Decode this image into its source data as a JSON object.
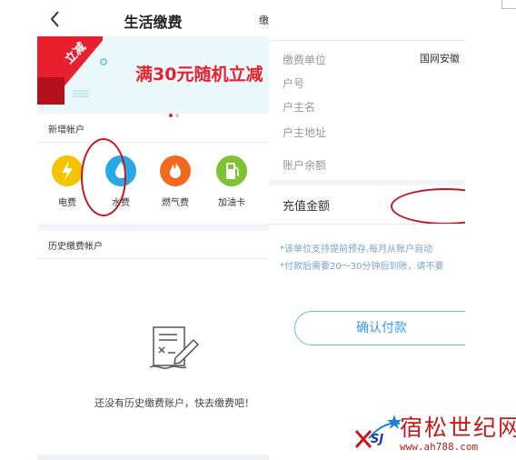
{
  "left_screen": {
    "nav": {
      "title": "生活缴费",
      "right_text": "缴"
    },
    "banner": {
      "badge": "立减",
      "promo_text": "满30元随机立减",
      "page_dots": 2
    },
    "new_account_section": {
      "title": "新增帐户",
      "services": [
        {
          "label": "电费",
          "icon": "lightning-icon",
          "color": "#f5c300"
        },
        {
          "label": "水费",
          "icon": "water-drop-icon",
          "color": "#2aa7e6"
        },
        {
          "label": "燃气费",
          "icon": "flame-icon",
          "color": "#f26a22"
        },
        {
          "label": "加油卡",
          "icon": "fuel-pump-icon",
          "color": "#7fc234"
        }
      ]
    },
    "history_section": {
      "title": "历史缴费帐户",
      "empty_text": "还没有历史缴费账户，快去缴费吧！"
    }
  },
  "right_screen": {
    "fields": [
      {
        "label": "缴费单位",
        "value": "国网安徽"
      },
      {
        "label": "户号",
        "value": ""
      },
      {
        "label": "户主名",
        "value": ""
      },
      {
        "label": "户主地址",
        "value": ""
      },
      {
        "label": "账户余额",
        "value": ""
      }
    ],
    "amount_label": "充值金额",
    "notes": [
      "*该单位支持提前预存,每月从账户自动",
      "*付款后需要20～30分钟后到账，请不要"
    ],
    "confirm_button": "确认付款"
  },
  "watermark": {
    "name": "宿松世纪网",
    "url": "www.ah788.com",
    "logo_text": "SJ"
  },
  "colors": {
    "annotation_red": "#c0181f",
    "accent_blue": "#3a9fe0",
    "promo_red": "#e8202e"
  }
}
